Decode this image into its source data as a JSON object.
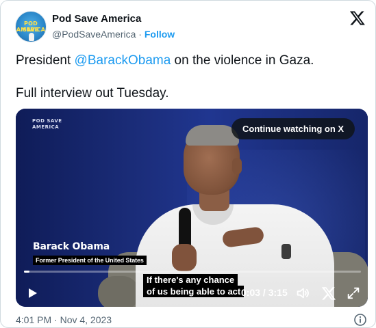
{
  "account": {
    "avatar_text_line1": "POD SAVE",
    "avatar_text_line2": "AMERICA",
    "name": "Pod Save America",
    "handle": "@PodSaveAmerica",
    "separator": "·",
    "follow_label": "Follow"
  },
  "tweet": {
    "line1_prefix": "President ",
    "mention": "@BarackObama",
    "line1_suffix": " on the violence in Gaza.",
    "line2": "Full interview out Tuesday."
  },
  "video": {
    "brand_line1": "POD SAVE",
    "brand_line2": "AMERICA",
    "continue_label": "Continue watching on X",
    "lower_third_name": "Barack Obama",
    "lower_third_title": "Former President of the United States",
    "caption_line1": "If there's any chance",
    "caption_line2": "of us being able to act",
    "current_time": "0:03",
    "duration": "3:15",
    "time_separator": " / ",
    "progress_fraction": 0.016
  },
  "footer": {
    "timestamp": "4:01 PM · Nov 4, 2023"
  },
  "colors": {
    "accent": "#1d9bf0",
    "text_primary": "#0f1419",
    "text_secondary": "#536471"
  },
  "icons": {
    "logo": "x-logo-icon",
    "play": "play-icon",
    "volume": "volume-icon",
    "close_video": "x-icon",
    "expand": "expand-icon",
    "info": "info-icon"
  }
}
